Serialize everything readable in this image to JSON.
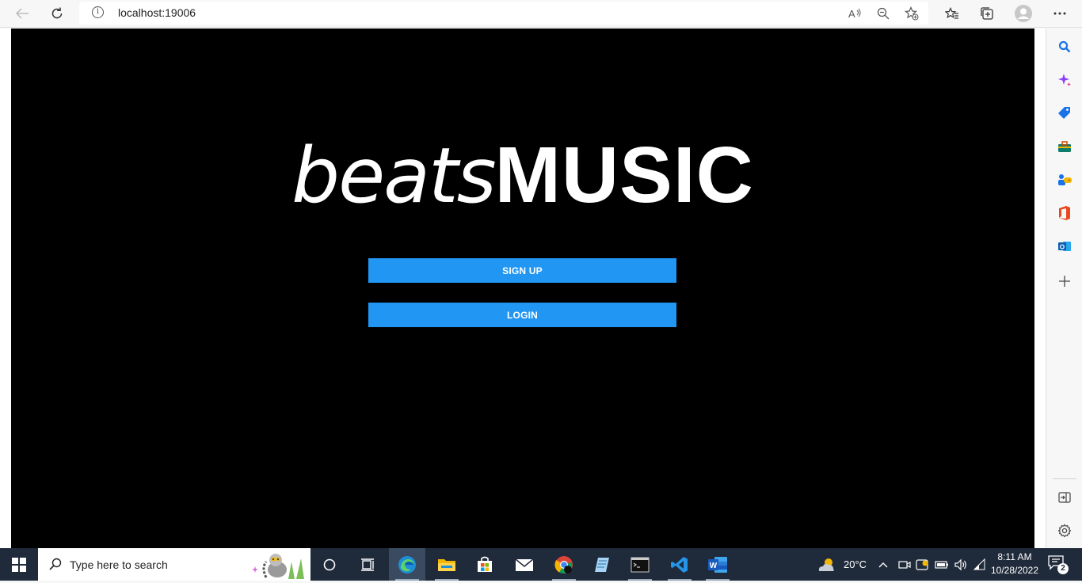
{
  "browser": {
    "url": "localhost:19006",
    "info_glyph": "i"
  },
  "page": {
    "logo_part1": "beats",
    "logo_part2": "MUSIC",
    "signup_label": "SIGN UP",
    "login_label": "LOGIN",
    "button_color": "#2196f3",
    "background_color": "#000000"
  },
  "taskbar": {
    "search_placeholder": "Type here to search",
    "temperature": "20°C",
    "time": "8:11 AM",
    "date": "10/28/2022",
    "notification_count": "2"
  }
}
